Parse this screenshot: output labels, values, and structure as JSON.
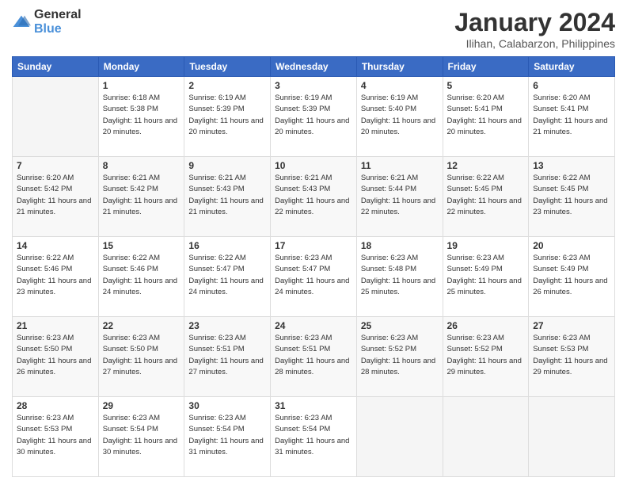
{
  "header": {
    "logo_general": "General",
    "logo_blue": "Blue",
    "month": "January 2024",
    "location": "Ilihan, Calabarzon, Philippines"
  },
  "days_of_week": [
    "Sunday",
    "Monday",
    "Tuesday",
    "Wednesday",
    "Thursday",
    "Friday",
    "Saturday"
  ],
  "weeks": [
    [
      {
        "day": "",
        "sunrise": "",
        "sunset": "",
        "daylight": ""
      },
      {
        "day": "1",
        "sunrise": "6:18 AM",
        "sunset": "5:38 PM",
        "daylight": "11 hours and 20 minutes."
      },
      {
        "day": "2",
        "sunrise": "6:19 AM",
        "sunset": "5:39 PM",
        "daylight": "11 hours and 20 minutes."
      },
      {
        "day": "3",
        "sunrise": "6:19 AM",
        "sunset": "5:39 PM",
        "daylight": "11 hours and 20 minutes."
      },
      {
        "day": "4",
        "sunrise": "6:19 AM",
        "sunset": "5:40 PM",
        "daylight": "11 hours and 20 minutes."
      },
      {
        "day": "5",
        "sunrise": "6:20 AM",
        "sunset": "5:41 PM",
        "daylight": "11 hours and 20 minutes."
      },
      {
        "day": "6",
        "sunrise": "6:20 AM",
        "sunset": "5:41 PM",
        "daylight": "11 hours and 21 minutes."
      }
    ],
    [
      {
        "day": "7",
        "sunrise": "6:20 AM",
        "sunset": "5:42 PM",
        "daylight": "11 hours and 21 minutes."
      },
      {
        "day": "8",
        "sunrise": "6:21 AM",
        "sunset": "5:42 PM",
        "daylight": "11 hours and 21 minutes."
      },
      {
        "day": "9",
        "sunrise": "6:21 AM",
        "sunset": "5:43 PM",
        "daylight": "11 hours and 21 minutes."
      },
      {
        "day": "10",
        "sunrise": "6:21 AM",
        "sunset": "5:43 PM",
        "daylight": "11 hours and 22 minutes."
      },
      {
        "day": "11",
        "sunrise": "6:21 AM",
        "sunset": "5:44 PM",
        "daylight": "11 hours and 22 minutes."
      },
      {
        "day": "12",
        "sunrise": "6:22 AM",
        "sunset": "5:45 PM",
        "daylight": "11 hours and 22 minutes."
      },
      {
        "day": "13",
        "sunrise": "6:22 AM",
        "sunset": "5:45 PM",
        "daylight": "11 hours and 23 minutes."
      }
    ],
    [
      {
        "day": "14",
        "sunrise": "6:22 AM",
        "sunset": "5:46 PM",
        "daylight": "11 hours and 23 minutes."
      },
      {
        "day": "15",
        "sunrise": "6:22 AM",
        "sunset": "5:46 PM",
        "daylight": "11 hours and 24 minutes."
      },
      {
        "day": "16",
        "sunrise": "6:22 AM",
        "sunset": "5:47 PM",
        "daylight": "11 hours and 24 minutes."
      },
      {
        "day": "17",
        "sunrise": "6:23 AM",
        "sunset": "5:47 PM",
        "daylight": "11 hours and 24 minutes."
      },
      {
        "day": "18",
        "sunrise": "6:23 AM",
        "sunset": "5:48 PM",
        "daylight": "11 hours and 25 minutes."
      },
      {
        "day": "19",
        "sunrise": "6:23 AM",
        "sunset": "5:49 PM",
        "daylight": "11 hours and 25 minutes."
      },
      {
        "day": "20",
        "sunrise": "6:23 AM",
        "sunset": "5:49 PM",
        "daylight": "11 hours and 26 minutes."
      }
    ],
    [
      {
        "day": "21",
        "sunrise": "6:23 AM",
        "sunset": "5:50 PM",
        "daylight": "11 hours and 26 minutes."
      },
      {
        "day": "22",
        "sunrise": "6:23 AM",
        "sunset": "5:50 PM",
        "daylight": "11 hours and 27 minutes."
      },
      {
        "day": "23",
        "sunrise": "6:23 AM",
        "sunset": "5:51 PM",
        "daylight": "11 hours and 27 minutes."
      },
      {
        "day": "24",
        "sunrise": "6:23 AM",
        "sunset": "5:51 PM",
        "daylight": "11 hours and 28 minutes."
      },
      {
        "day": "25",
        "sunrise": "6:23 AM",
        "sunset": "5:52 PM",
        "daylight": "11 hours and 28 minutes."
      },
      {
        "day": "26",
        "sunrise": "6:23 AM",
        "sunset": "5:52 PM",
        "daylight": "11 hours and 29 minutes."
      },
      {
        "day": "27",
        "sunrise": "6:23 AM",
        "sunset": "5:53 PM",
        "daylight": "11 hours and 29 minutes."
      }
    ],
    [
      {
        "day": "28",
        "sunrise": "6:23 AM",
        "sunset": "5:53 PM",
        "daylight": "11 hours and 30 minutes."
      },
      {
        "day": "29",
        "sunrise": "6:23 AM",
        "sunset": "5:54 PM",
        "daylight": "11 hours and 30 minutes."
      },
      {
        "day": "30",
        "sunrise": "6:23 AM",
        "sunset": "5:54 PM",
        "daylight": "11 hours and 31 minutes."
      },
      {
        "day": "31",
        "sunrise": "6:23 AM",
        "sunset": "5:54 PM",
        "daylight": "11 hours and 31 minutes."
      },
      {
        "day": "",
        "sunrise": "",
        "sunset": "",
        "daylight": ""
      },
      {
        "day": "",
        "sunrise": "",
        "sunset": "",
        "daylight": ""
      },
      {
        "day": "",
        "sunrise": "",
        "sunset": "",
        "daylight": ""
      }
    ]
  ]
}
